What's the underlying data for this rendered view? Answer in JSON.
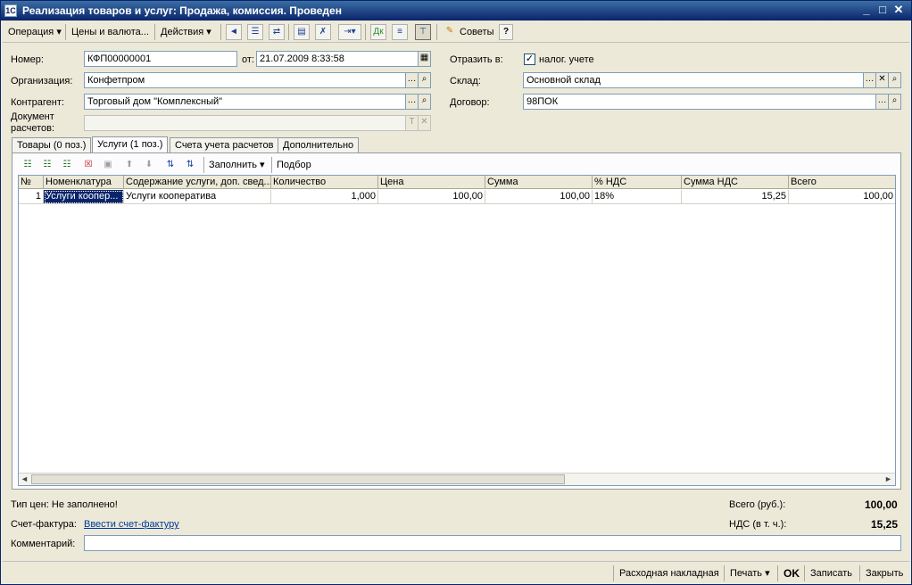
{
  "window": {
    "title": "Реализация товаров и услуг: Продажа, комиссия. Проведен",
    "minimize": "_",
    "maximize": "□",
    "close": "✕"
  },
  "toolbar": {
    "operation": "Операция ▾",
    "prices": "Цены и валюта...",
    "actions": "Действия ▾",
    "tips": "Советы",
    "help": "?"
  },
  "form": {
    "number_label": "Номер:",
    "number_value": "КФП00000001",
    "date_label": "от:",
    "date_value": "21.07.2009  8:33:58",
    "org_label": "Организация:",
    "org_value": "Конфетпром",
    "contractor_label": "Контрагент:",
    "contractor_value": "Торговый дом \"Комплексный\"",
    "doc_label_1": "Документ",
    "doc_label_2": "расчетов:",
    "reflect_label": "Отразить в:",
    "tax_label": "налог. учете",
    "tax_checked": "✓",
    "warehouse_label": "Склад:",
    "warehouse_value": "Основной склад",
    "contract_label": "Договор:",
    "contract_value": "98ПОК"
  },
  "tabs": [
    {
      "label": "Товары (0 поз.)"
    },
    {
      "label": "Услуги (1 поз.)"
    },
    {
      "label": "Счета учета расчетов"
    },
    {
      "label": "Дополнительно"
    }
  ],
  "panel_toolbar": {
    "fill": "Заполнить ▾",
    "pick": "Подбор"
  },
  "table": {
    "columns": [
      "№",
      "Номенклатура",
      "Содержание услуги, доп. свед...",
      "Количество",
      "Цена",
      "Сумма",
      "% НДС",
      "Сумма НДС",
      "Всего"
    ],
    "rows": [
      [
        "1",
        "Услуги коопер...",
        "Услуги кооператива",
        "1,000",
        "100,00",
        "100,00",
        "18%",
        "15,25",
        "100,00"
      ]
    ]
  },
  "footer": {
    "price_type": "Тип цен: Не заполнено!",
    "total_label": "Всего (руб.):",
    "total_value": "100,00",
    "invoice_label": "Счет-фактура:",
    "invoice_link": "Ввести счет-фактуру",
    "vat_label": "НДС (в т. ч.):",
    "vat_value": "15,25",
    "comment_label": "Комментарий:",
    "comment_value": ""
  },
  "status": {
    "waybill": "Расходная накладная",
    "print": "Печать ▾",
    "ok": "OK",
    "save": "Записать",
    "close": "Закрыть"
  }
}
